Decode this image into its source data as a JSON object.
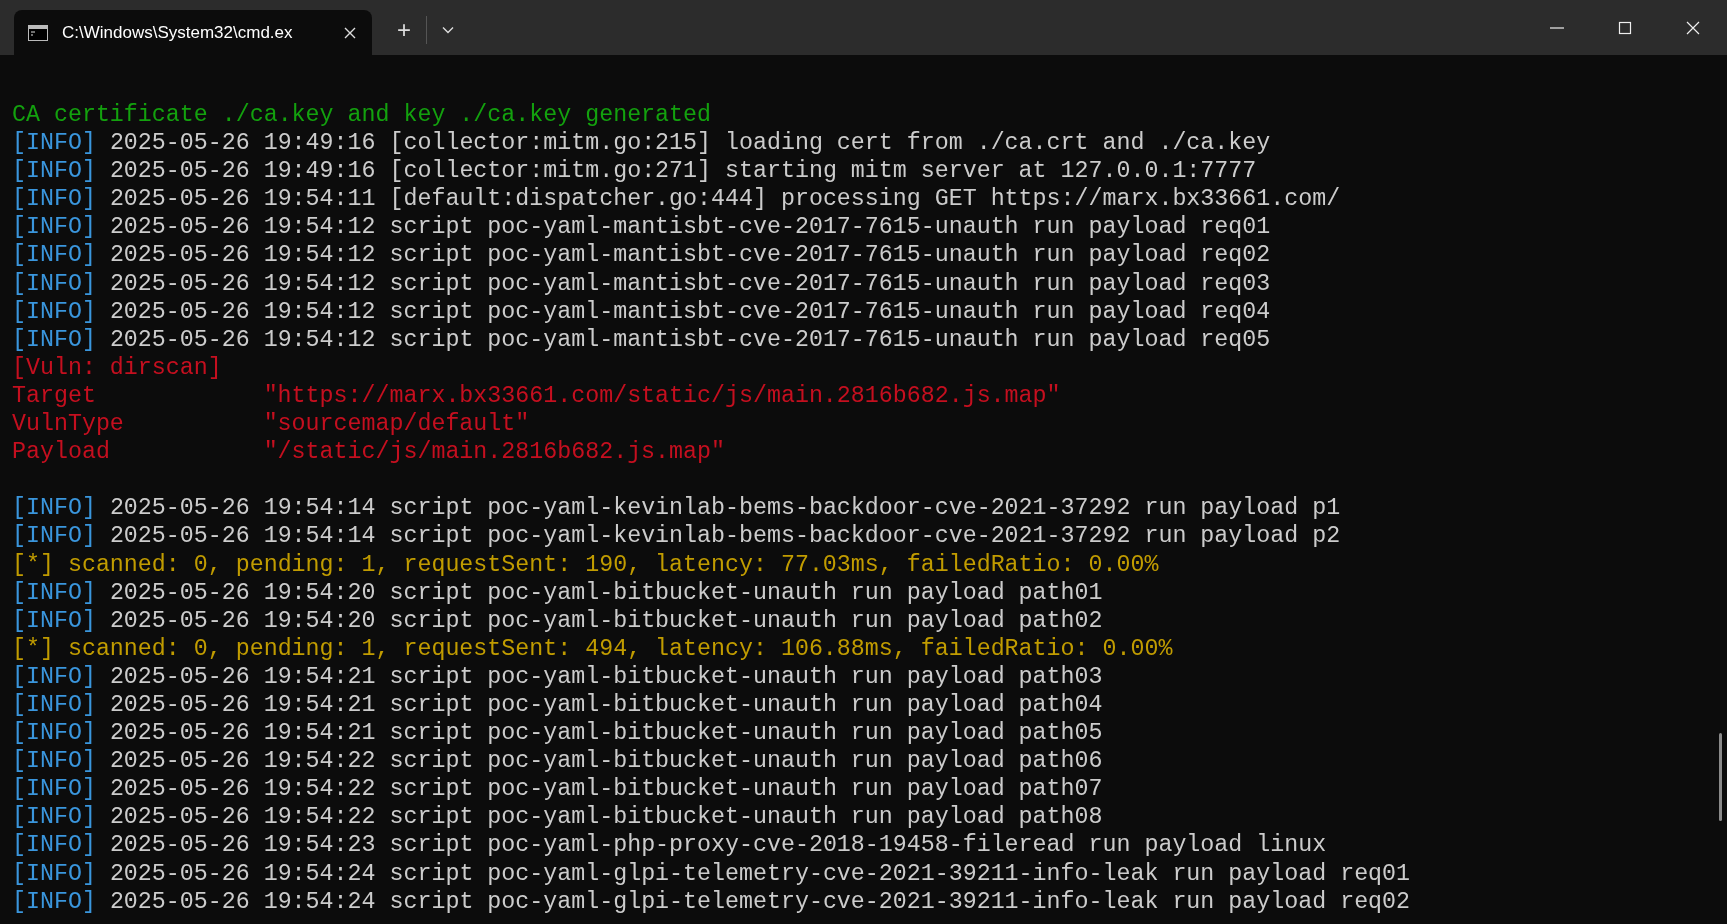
{
  "window": {
    "tab_title": "C:\\Windows\\System32\\cmd.ex",
    "new_tab": "+"
  },
  "lines": [
    {
      "kind": "success",
      "text": "CA certificate ./ca.key and key ./ca.key generated"
    },
    {
      "kind": "info",
      "tag": "[INFO]",
      "text": "2025-05-26 19:49:16 [collector:mitm.go:215] loading cert from ./ca.crt and ./ca.key"
    },
    {
      "kind": "info",
      "tag": "[INFO]",
      "text": "2025-05-26 19:49:16 [collector:mitm.go:271] starting mitm server at 127.0.0.1:7777"
    },
    {
      "kind": "info",
      "tag": "[INFO]",
      "text": "2025-05-26 19:54:11 [default:dispatcher.go:444] processing GET https://marx.bx33661.com/"
    },
    {
      "kind": "info",
      "tag": "[INFO]",
      "text": "2025-05-26 19:54:12 script poc-yaml-mantisbt-cve-2017-7615-unauth run payload req01"
    },
    {
      "kind": "info",
      "tag": "[INFO]",
      "text": "2025-05-26 19:54:12 script poc-yaml-mantisbt-cve-2017-7615-unauth run payload req02"
    },
    {
      "kind": "info",
      "tag": "[INFO]",
      "text": "2025-05-26 19:54:12 script poc-yaml-mantisbt-cve-2017-7615-unauth run payload req03"
    },
    {
      "kind": "info",
      "tag": "[INFO]",
      "text": "2025-05-26 19:54:12 script poc-yaml-mantisbt-cve-2017-7615-unauth run payload req04"
    },
    {
      "kind": "info",
      "tag": "[INFO]",
      "text": "2025-05-26 19:54:12 script poc-yaml-mantisbt-cve-2017-7615-unauth run payload req05"
    },
    {
      "kind": "vuln",
      "text": "[Vuln: dirscan]"
    },
    {
      "kind": "field",
      "label": "Target",
      "value": "\"https://marx.bx33661.com/static/js/main.2816b682.js.map\""
    },
    {
      "kind": "field",
      "label": "VulnType",
      "value": "\"sourcemap/default\""
    },
    {
      "kind": "field",
      "label": "Payload",
      "value": "\"/static/js/main.2816b682.js.map\""
    },
    {
      "kind": "blank"
    },
    {
      "kind": "info",
      "tag": "[INFO]",
      "text": "2025-05-26 19:54:14 script poc-yaml-kevinlab-bems-backdoor-cve-2021-37292 run payload p1"
    },
    {
      "kind": "info",
      "tag": "[INFO]",
      "text": "2025-05-26 19:54:14 script poc-yaml-kevinlab-bems-backdoor-cve-2021-37292 run payload p2"
    },
    {
      "kind": "status",
      "text": "[*] scanned: 0, pending: 1, requestSent: 190, latency: 77.03ms, failedRatio: 0.00%"
    },
    {
      "kind": "info",
      "tag": "[INFO]",
      "text": "2025-05-26 19:54:20 script poc-yaml-bitbucket-unauth run payload path01"
    },
    {
      "kind": "info",
      "tag": "[INFO]",
      "text": "2025-05-26 19:54:20 script poc-yaml-bitbucket-unauth run payload path02"
    },
    {
      "kind": "status",
      "text": "[*] scanned: 0, pending: 1, requestSent: 494, latency: 106.88ms, failedRatio: 0.00%"
    },
    {
      "kind": "info",
      "tag": "[INFO]",
      "text": "2025-05-26 19:54:21 script poc-yaml-bitbucket-unauth run payload path03"
    },
    {
      "kind": "info",
      "tag": "[INFO]",
      "text": "2025-05-26 19:54:21 script poc-yaml-bitbucket-unauth run payload path04"
    },
    {
      "kind": "info",
      "tag": "[INFO]",
      "text": "2025-05-26 19:54:21 script poc-yaml-bitbucket-unauth run payload path05"
    },
    {
      "kind": "info",
      "tag": "[INFO]",
      "text": "2025-05-26 19:54:22 script poc-yaml-bitbucket-unauth run payload path06"
    },
    {
      "kind": "info",
      "tag": "[INFO]",
      "text": "2025-05-26 19:54:22 script poc-yaml-bitbucket-unauth run payload path07"
    },
    {
      "kind": "info",
      "tag": "[INFO]",
      "text": "2025-05-26 19:54:22 script poc-yaml-bitbucket-unauth run payload path08"
    },
    {
      "kind": "info",
      "tag": "[INFO]",
      "text": "2025-05-26 19:54:23 script poc-yaml-php-proxy-cve-2018-19458-fileread run payload linux"
    },
    {
      "kind": "info",
      "tag": "[INFO]",
      "text": "2025-05-26 19:54:24 script poc-yaml-glpi-telemetry-cve-2021-39211-info-leak run payload req01"
    },
    {
      "kind": "info",
      "tag": "[INFO]",
      "text": "2025-05-26 19:54:24 script poc-yaml-glpi-telemetry-cve-2021-39211-info-leak run payload req02"
    }
  ]
}
